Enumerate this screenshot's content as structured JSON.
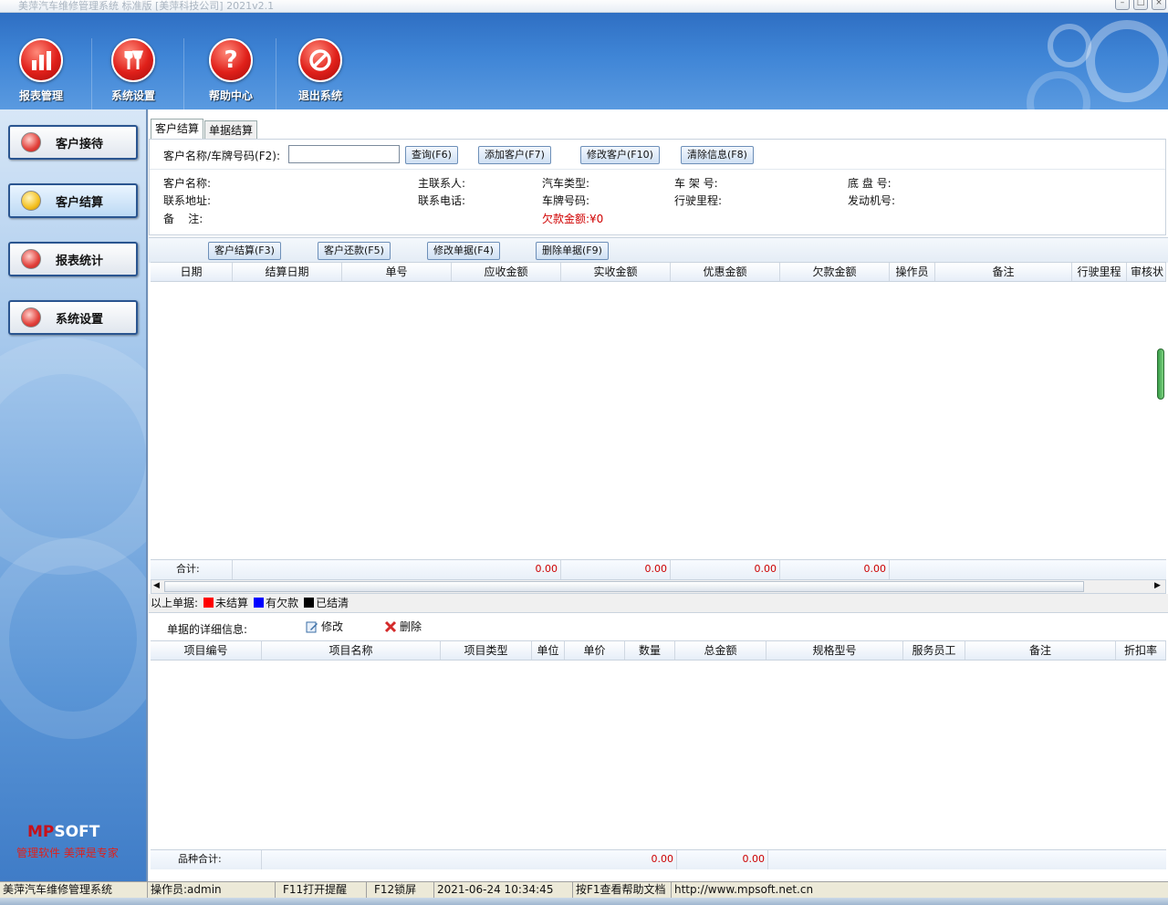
{
  "window": {
    "title": "美萍汽车维修管理系统 标准版 [美萍科技公司] 2021v2.1"
  },
  "toolbar": {
    "items": [
      {
        "label": "报表管理"
      },
      {
        "label": "系统设置"
      },
      {
        "label": "帮助中心"
      },
      {
        "label": "退出系统"
      }
    ]
  },
  "sidebar": {
    "items": [
      {
        "label": "客户接待"
      },
      {
        "label": "客户结算"
      },
      {
        "label": "报表统计"
      },
      {
        "label": "系统设置"
      }
    ],
    "logo_mp": "MP",
    "logo_soft": "SOFT",
    "slogan": "管理软件 美萍是专家"
  },
  "tabs": [
    {
      "label": "客户结算"
    },
    {
      "label": "单据结算"
    }
  ],
  "query": {
    "label": "客户名称/车牌号码(F2):",
    "input_value": "",
    "buttons": {
      "search": "查询(F6)",
      "add": "添加客户(F7)",
      "edit": "修改客户(F10)",
      "clear": "清除信息(F8)"
    }
  },
  "customer_info": {
    "name": "客户名称:",
    "contact": "主联系人:",
    "car_type": "汽车类型:",
    "frame_no": "车 架 号:",
    "chassis_no": "底 盘 号:",
    "address": "联系地址:",
    "phone": "联系电话:",
    "plate": "车牌号码:",
    "mileage": "行驶里程:",
    "engine_no": "发动机号:",
    "remark": "备    注:",
    "debt": "欠款金额:¥0"
  },
  "actions": {
    "settle": "客户结算(F3)",
    "repay": "客户还款(F5)",
    "edit": "修改单据(F4)",
    "delete": "删除单据(F9)"
  },
  "bills_table": {
    "headers": [
      "日期",
      "结算日期",
      "单号",
      "应收金额",
      "实收金额",
      "优惠金额",
      "欠款金额",
      "操作员",
      "备注",
      "行驶里程",
      "审核状"
    ],
    "sum_label": "合计:",
    "sums": [
      "0.00",
      "0.00",
      "0.00",
      "0.00"
    ]
  },
  "legend": {
    "title": "以上单据:",
    "unsettled": "未结算",
    "debt": "有欠款",
    "cleared": "已结清",
    "colors": {
      "unsettled": "#ff0000",
      "debt": "#0000ff",
      "cleared": "#000000"
    }
  },
  "detail": {
    "title": "单据的详细信息:",
    "edit": "修改",
    "delete": "删除"
  },
  "items_table": {
    "headers": [
      "项目编号",
      "项目名称",
      "项目类型",
      "单位",
      "单价",
      "数量",
      "总金额",
      "规格型号",
      "服务员工",
      "备注",
      "折扣率"
    ],
    "sum_label": "品种合计:",
    "sums": [
      "0.00",
      "0.00"
    ]
  },
  "status": {
    "app": "美萍汽车维修管理系统",
    "operator": "操作员:admin",
    "f11": "F11打开提醒",
    "f12": "F12锁屏",
    "datetime": "2021-06-24 10:34:45",
    "help": "按F1查看帮助文档",
    "url": "http://www.mpsoft.net.cn"
  }
}
